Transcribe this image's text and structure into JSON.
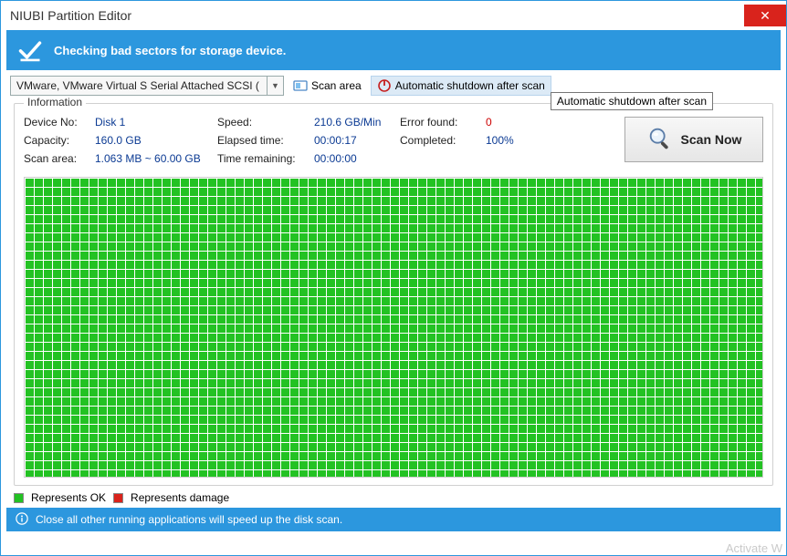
{
  "window": {
    "title": "NIUBI Partition Editor"
  },
  "banner": {
    "message": "Checking bad sectors for storage device."
  },
  "toolbar": {
    "device_combo_value": "VMware, VMware Virtual S Serial Attached SCSI (",
    "scan_area_label": "Scan area",
    "auto_shutdown_label": "Automatic shutdown after scan",
    "tooltip": "Automatic shutdown after scan"
  },
  "info": {
    "legend": "Information",
    "device_no_label": "Device No:",
    "device_no_value": "Disk 1",
    "capacity_label": "Capacity:",
    "capacity_value": "160.0 GB",
    "scan_area_label": "Scan area:",
    "scan_area_value": "1.063 MB ~ 60.00 GB",
    "speed_label": "Speed:",
    "speed_value": "210.6 GB/Min",
    "elapsed_label": "Elapsed time:",
    "elapsed_value": "00:00:17",
    "remaining_label": "Time remaining:",
    "remaining_value": "00:00:00",
    "errors_label": "Error found:",
    "errors_value": "0",
    "completed_label": "Completed:",
    "completed_value": "100%",
    "scan_now_label": "Scan Now"
  },
  "legend_row": {
    "ok_label": "Represents OK",
    "bad_label": "Represents damage"
  },
  "footer": {
    "tip": "Close all other running applications will speed up the disk scan."
  },
  "watermark": "Activate W",
  "colors": {
    "accent": "#2c97de",
    "ok": "#23c223",
    "error": "#d9231c",
    "value_text": "#0b3a93"
  }
}
